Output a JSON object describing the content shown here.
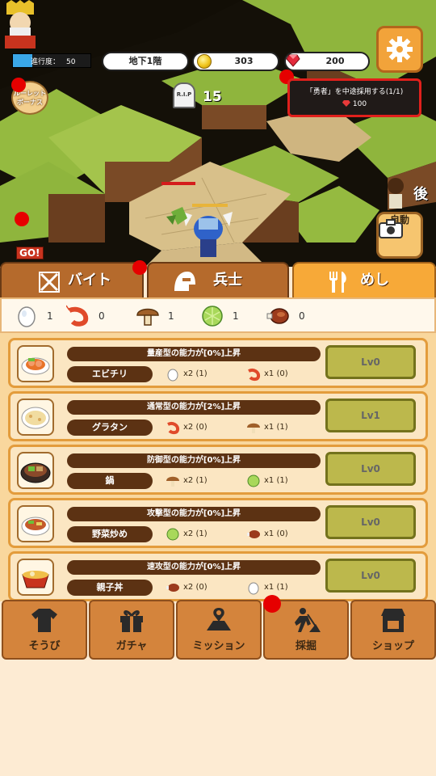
{
  "hud": {
    "progress_label": "進行度：",
    "progress_value": "50",
    "progress_fraction": 0.25,
    "floor": "地下1階",
    "coins": "303",
    "gems": "200"
  },
  "scene": {
    "roulette_label_1": "ルーレット",
    "roulette_label_2": "ボーナス",
    "rip_label": "R.I.P",
    "death_count": "15",
    "quest_line1": "「勇者」を中途採用する(1/1)",
    "quest_reward": "100",
    "side_name": "後",
    "auto_label": "自動",
    "go_label": "GO!"
  },
  "tabs": [
    {
      "label": "バイト",
      "icon": "crossed-swords-icon"
    },
    {
      "label": "兵士",
      "icon": "helmet-icon"
    },
    {
      "label": "めし",
      "icon": "fork-knife-icon"
    }
  ],
  "ingredients": [
    {
      "name": "egg",
      "count": "1"
    },
    {
      "name": "shrimp",
      "count": "0"
    },
    {
      "name": "mushroom",
      "count": "1"
    },
    {
      "name": "cabbage",
      "count": "1"
    },
    {
      "name": "meat",
      "count": "0"
    }
  ],
  "recipes": [
    {
      "effect": "量産型の能力が[0%]上昇",
      "name": "エビチリ",
      "req1": "x2 (1)",
      "req2": "x1 (0)",
      "level": "Lv0"
    },
    {
      "effect": "通常型の能力が[2%]上昇",
      "name": "グラタン",
      "req1": "x2 (0)",
      "req2": "x1 (1)",
      "level": "Lv1"
    },
    {
      "effect": "防御型の能力が[0%]上昇",
      "name": "鍋",
      "req1": "x2 (1)",
      "req2": "x1 (1)",
      "level": "Lv0"
    },
    {
      "effect": "攻撃型の能力が[0%]上昇",
      "name": "野菜炒め",
      "req1": "x2 (1)",
      "req2": "x1 (0)",
      "level": "Lv0"
    },
    {
      "effect": "速攻型の能力が[0%]上昇",
      "name": "親子丼",
      "req1": "x2 (0)",
      "req2": "x1 (1)",
      "level": "Lv0"
    }
  ],
  "nav": [
    {
      "label": "そうび",
      "icon": "shirt-icon"
    },
    {
      "label": "ガチャ",
      "icon": "gift-icon"
    },
    {
      "label": "ミッション",
      "icon": "map-icon"
    },
    {
      "label": "採掘",
      "icon": "dig-icon"
    },
    {
      "label": "ショップ",
      "icon": "shop-icon"
    }
  ],
  "colors": {
    "accent_tab": "#f7a938",
    "badge_red": "#e60000",
    "level_button": "#bcb84c"
  }
}
